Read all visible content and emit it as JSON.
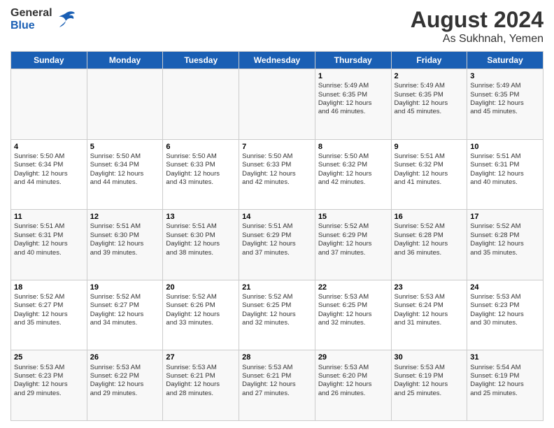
{
  "header": {
    "logo": {
      "general": "General",
      "blue": "Blue"
    },
    "title": "August 2024",
    "subtitle": "As Sukhnah, Yemen"
  },
  "weekdays": [
    "Sunday",
    "Monday",
    "Tuesday",
    "Wednesday",
    "Thursday",
    "Friday",
    "Saturday"
  ],
  "weeks": [
    [
      {
        "day": "",
        "info": ""
      },
      {
        "day": "",
        "info": ""
      },
      {
        "day": "",
        "info": ""
      },
      {
        "day": "",
        "info": ""
      },
      {
        "day": "1",
        "info": "Sunrise: 5:49 AM\nSunset: 6:35 PM\nDaylight: 12 hours\nand 46 minutes."
      },
      {
        "day": "2",
        "info": "Sunrise: 5:49 AM\nSunset: 6:35 PM\nDaylight: 12 hours\nand 45 minutes."
      },
      {
        "day": "3",
        "info": "Sunrise: 5:49 AM\nSunset: 6:35 PM\nDaylight: 12 hours\nand 45 minutes."
      }
    ],
    [
      {
        "day": "4",
        "info": "Sunrise: 5:50 AM\nSunset: 6:34 PM\nDaylight: 12 hours\nand 44 minutes."
      },
      {
        "day": "5",
        "info": "Sunrise: 5:50 AM\nSunset: 6:34 PM\nDaylight: 12 hours\nand 44 minutes."
      },
      {
        "day": "6",
        "info": "Sunrise: 5:50 AM\nSunset: 6:33 PM\nDaylight: 12 hours\nand 43 minutes."
      },
      {
        "day": "7",
        "info": "Sunrise: 5:50 AM\nSunset: 6:33 PM\nDaylight: 12 hours\nand 42 minutes."
      },
      {
        "day": "8",
        "info": "Sunrise: 5:50 AM\nSunset: 6:32 PM\nDaylight: 12 hours\nand 42 minutes."
      },
      {
        "day": "9",
        "info": "Sunrise: 5:51 AM\nSunset: 6:32 PM\nDaylight: 12 hours\nand 41 minutes."
      },
      {
        "day": "10",
        "info": "Sunrise: 5:51 AM\nSunset: 6:31 PM\nDaylight: 12 hours\nand 40 minutes."
      }
    ],
    [
      {
        "day": "11",
        "info": "Sunrise: 5:51 AM\nSunset: 6:31 PM\nDaylight: 12 hours\nand 40 minutes."
      },
      {
        "day": "12",
        "info": "Sunrise: 5:51 AM\nSunset: 6:30 PM\nDaylight: 12 hours\nand 39 minutes."
      },
      {
        "day": "13",
        "info": "Sunrise: 5:51 AM\nSunset: 6:30 PM\nDaylight: 12 hours\nand 38 minutes."
      },
      {
        "day": "14",
        "info": "Sunrise: 5:51 AM\nSunset: 6:29 PM\nDaylight: 12 hours\nand 37 minutes."
      },
      {
        "day": "15",
        "info": "Sunrise: 5:52 AM\nSunset: 6:29 PM\nDaylight: 12 hours\nand 37 minutes."
      },
      {
        "day": "16",
        "info": "Sunrise: 5:52 AM\nSunset: 6:28 PM\nDaylight: 12 hours\nand 36 minutes."
      },
      {
        "day": "17",
        "info": "Sunrise: 5:52 AM\nSunset: 6:28 PM\nDaylight: 12 hours\nand 35 minutes."
      }
    ],
    [
      {
        "day": "18",
        "info": "Sunrise: 5:52 AM\nSunset: 6:27 PM\nDaylight: 12 hours\nand 35 minutes."
      },
      {
        "day": "19",
        "info": "Sunrise: 5:52 AM\nSunset: 6:27 PM\nDaylight: 12 hours\nand 34 minutes."
      },
      {
        "day": "20",
        "info": "Sunrise: 5:52 AM\nSunset: 6:26 PM\nDaylight: 12 hours\nand 33 minutes."
      },
      {
        "day": "21",
        "info": "Sunrise: 5:52 AM\nSunset: 6:25 PM\nDaylight: 12 hours\nand 32 minutes."
      },
      {
        "day": "22",
        "info": "Sunrise: 5:53 AM\nSunset: 6:25 PM\nDaylight: 12 hours\nand 32 minutes."
      },
      {
        "day": "23",
        "info": "Sunrise: 5:53 AM\nSunset: 6:24 PM\nDaylight: 12 hours\nand 31 minutes."
      },
      {
        "day": "24",
        "info": "Sunrise: 5:53 AM\nSunset: 6:23 PM\nDaylight: 12 hours\nand 30 minutes."
      }
    ],
    [
      {
        "day": "25",
        "info": "Sunrise: 5:53 AM\nSunset: 6:23 PM\nDaylight: 12 hours\nand 29 minutes."
      },
      {
        "day": "26",
        "info": "Sunrise: 5:53 AM\nSunset: 6:22 PM\nDaylight: 12 hours\nand 29 minutes."
      },
      {
        "day": "27",
        "info": "Sunrise: 5:53 AM\nSunset: 6:21 PM\nDaylight: 12 hours\nand 28 minutes."
      },
      {
        "day": "28",
        "info": "Sunrise: 5:53 AM\nSunset: 6:21 PM\nDaylight: 12 hours\nand 27 minutes."
      },
      {
        "day": "29",
        "info": "Sunrise: 5:53 AM\nSunset: 6:20 PM\nDaylight: 12 hours\nand 26 minutes."
      },
      {
        "day": "30",
        "info": "Sunrise: 5:53 AM\nSunset: 6:19 PM\nDaylight: 12 hours\nand 25 minutes."
      },
      {
        "day": "31",
        "info": "Sunrise: 5:54 AM\nSunset: 6:19 PM\nDaylight: 12 hours\nand 25 minutes."
      }
    ]
  ]
}
